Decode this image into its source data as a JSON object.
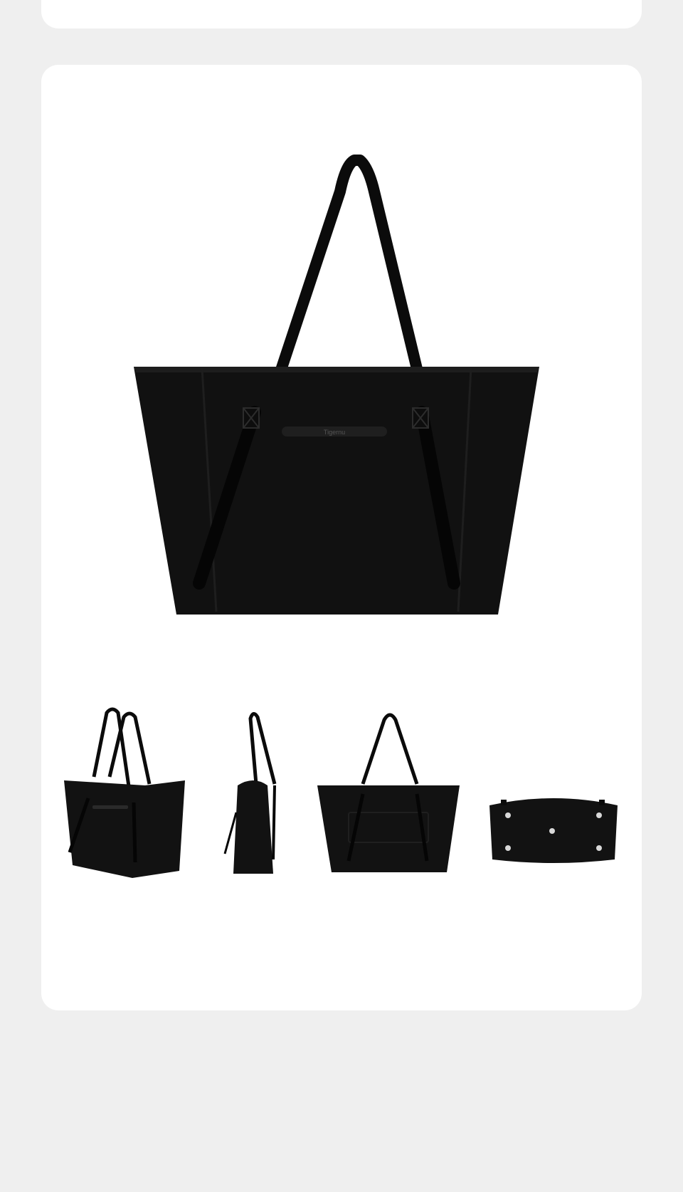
{
  "product": {
    "hero_image": "black-tote-bag-front-view",
    "brand_mark": "Tigernu",
    "gallery": [
      "black-tote-bag-angle-view",
      "black-tote-bag-side-view",
      "black-tote-bag-back-view",
      "black-tote-bag-bottom-view"
    ]
  },
  "colors": {
    "page_background": "#efefef",
    "card_background": "#ffffff",
    "bag_black": "#111111"
  }
}
